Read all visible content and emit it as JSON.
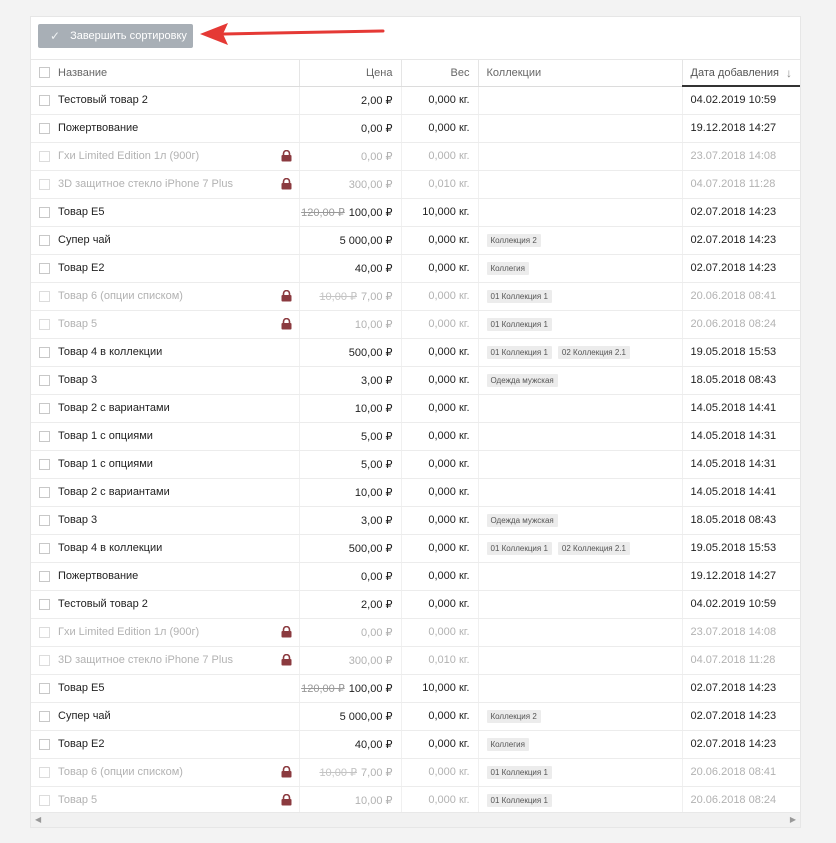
{
  "toolbar": {
    "finish_label": "Завершить сортировку"
  },
  "table": {
    "headers": {
      "name": "Название",
      "price": "Цена",
      "weight": "Вес",
      "collections": "Коллекции",
      "date": "Дата добавления"
    },
    "rows": [
      {
        "name": "Тестовый товар 2",
        "old_price": "",
        "price": "2,00 ₽",
        "weight": "0,000 кг.",
        "tags": [],
        "date": "04.02.2019 10:59",
        "locked": false
      },
      {
        "name": "Пожертвование",
        "old_price": "",
        "price": "0,00 ₽",
        "weight": "0,000 кг.",
        "tags": [],
        "date": "19.12.2018 14:27",
        "locked": false
      },
      {
        "name": "Гхи Limited Edition 1л (900г)",
        "old_price": "",
        "price": "0,00 ₽",
        "weight": "0,000 кг.",
        "tags": [],
        "date": "23.07.2018 14:08",
        "locked": true
      },
      {
        "name": "3D защитное стекло iPhone 7 Plus",
        "old_price": "",
        "price": "300,00 ₽",
        "weight": "0,010 кг.",
        "tags": [],
        "date": "04.07.2018 11:28",
        "locked": true
      },
      {
        "name": "Товар Е5",
        "old_price": "120,00 ₽",
        "price": "100,00 ₽",
        "weight": "10,000 кг.",
        "tags": [],
        "date": "02.07.2018 14:23",
        "locked": false
      },
      {
        "name": "Супер чай",
        "old_price": "",
        "price": "5 000,00 ₽",
        "weight": "0,000 кг.",
        "tags": [
          "Коллекция 2"
        ],
        "date": "02.07.2018 14:23",
        "locked": false
      },
      {
        "name": "Товар Е2",
        "old_price": "",
        "price": "40,00 ₽",
        "weight": "0,000 кг.",
        "tags": [
          "Коллегия"
        ],
        "date": "02.07.2018 14:23",
        "locked": false
      },
      {
        "name": "Товар 6 (опции списком)",
        "old_price": "10,00 ₽",
        "price": "7,00 ₽",
        "weight": "0,000 кг.",
        "tags": [
          "01 Коллекция 1"
        ],
        "date": "20.06.2018 08:41",
        "locked": true
      },
      {
        "name": "Товар 5",
        "old_price": "",
        "price": "10,00 ₽",
        "weight": "0,000 кг.",
        "tags": [
          "01 Коллекция 1"
        ],
        "date": "20.06.2018 08:24",
        "locked": true
      },
      {
        "name": "Товар 4 в коллекции",
        "old_price": "",
        "price": "500,00 ₽",
        "weight": "0,000 кг.",
        "tags": [
          "01 Коллекция 1",
          "02 Коллекция 2.1"
        ],
        "date": "19.05.2018 15:53",
        "locked": false
      },
      {
        "name": "Товар 3",
        "old_price": "",
        "price": "3,00 ₽",
        "weight": "0,000 кг.",
        "tags": [
          "Одежда мужская"
        ],
        "date": "18.05.2018 08:43",
        "locked": false
      },
      {
        "name": "Товар 2 с вариантами",
        "old_price": "",
        "price": "10,00 ₽",
        "weight": "0,000 кг.",
        "tags": [],
        "date": "14.05.2018 14:41",
        "locked": false
      },
      {
        "name": "Товар 1 с опциями",
        "old_price": "",
        "price": "5,00 ₽",
        "weight": "0,000 кг.",
        "tags": [],
        "date": "14.05.2018 14:31",
        "locked": false
      },
      {
        "name": "Товар 1 с опциями",
        "old_price": "",
        "price": "5,00 ₽",
        "weight": "0,000 кг.",
        "tags": [],
        "date": "14.05.2018 14:31",
        "locked": false
      },
      {
        "name": "Товар 2 с вариантами",
        "old_price": "",
        "price": "10,00 ₽",
        "weight": "0,000 кг.",
        "tags": [],
        "date": "14.05.2018 14:41",
        "locked": false
      },
      {
        "name": "Товар 3",
        "old_price": "",
        "price": "3,00 ₽",
        "weight": "0,000 кг.",
        "tags": [
          "Одежда мужская"
        ],
        "date": "18.05.2018 08:43",
        "locked": false
      },
      {
        "name": "Товар 4 в коллекции",
        "old_price": "",
        "price": "500,00 ₽",
        "weight": "0,000 кг.",
        "tags": [
          "01 Коллекция 1",
          "02 Коллекция 2.1"
        ],
        "date": "19.05.2018 15:53",
        "locked": false
      },
      {
        "name": "Пожертвование",
        "old_price": "",
        "price": "0,00 ₽",
        "weight": "0,000 кг.",
        "tags": [],
        "date": "19.12.2018 14:27",
        "locked": false
      },
      {
        "name": "Тестовый товар 2",
        "old_price": "",
        "price": "2,00 ₽",
        "weight": "0,000 кг.",
        "tags": [],
        "date": "04.02.2019 10:59",
        "locked": false
      },
      {
        "name": "Гхи Limited Edition 1л (900г)",
        "old_price": "",
        "price": "0,00 ₽",
        "weight": "0,000 кг.",
        "tags": [],
        "date": "23.07.2018 14:08",
        "locked": true
      },
      {
        "name": "3D защитное стекло iPhone 7 Plus",
        "old_price": "",
        "price": "300,00 ₽",
        "weight": "0,010 кг.",
        "tags": [],
        "date": "04.07.2018 11:28",
        "locked": true
      },
      {
        "name": "Товар Е5",
        "old_price": "120,00 ₽",
        "price": "100,00 ₽",
        "weight": "10,000 кг.",
        "tags": [],
        "date": "02.07.2018 14:23",
        "locked": false
      },
      {
        "name": "Супер чай",
        "old_price": "",
        "price": "5 000,00 ₽",
        "weight": "0,000 кг.",
        "tags": [
          "Коллекция 2"
        ],
        "date": "02.07.2018 14:23",
        "locked": false
      },
      {
        "name": "Товар Е2",
        "old_price": "",
        "price": "40,00 ₽",
        "weight": "0,000 кг.",
        "tags": [
          "Коллегия"
        ],
        "date": "02.07.2018 14:23",
        "locked": false
      },
      {
        "name": "Товар 6 (опции списком)",
        "old_price": "10,00 ₽",
        "price": "7,00 ₽",
        "weight": "0,000 кг.",
        "tags": [
          "01 Коллекция 1"
        ],
        "date": "20.06.2018 08:41",
        "locked": true
      },
      {
        "name": "Товар 5",
        "old_price": "",
        "price": "10,00 ₽",
        "weight": "0,000 кг.",
        "tags": [
          "01 Коллекция 1"
        ],
        "date": "20.06.2018 08:24",
        "locked": true
      }
    ]
  },
  "colors": {
    "lock": "#8b3a3f",
    "arrow": "#e53935",
    "button": "#a8afb6"
  },
  "icons": {
    "check": "check-icon",
    "lock": "lock-icon",
    "sort": "arrow-down-icon"
  }
}
